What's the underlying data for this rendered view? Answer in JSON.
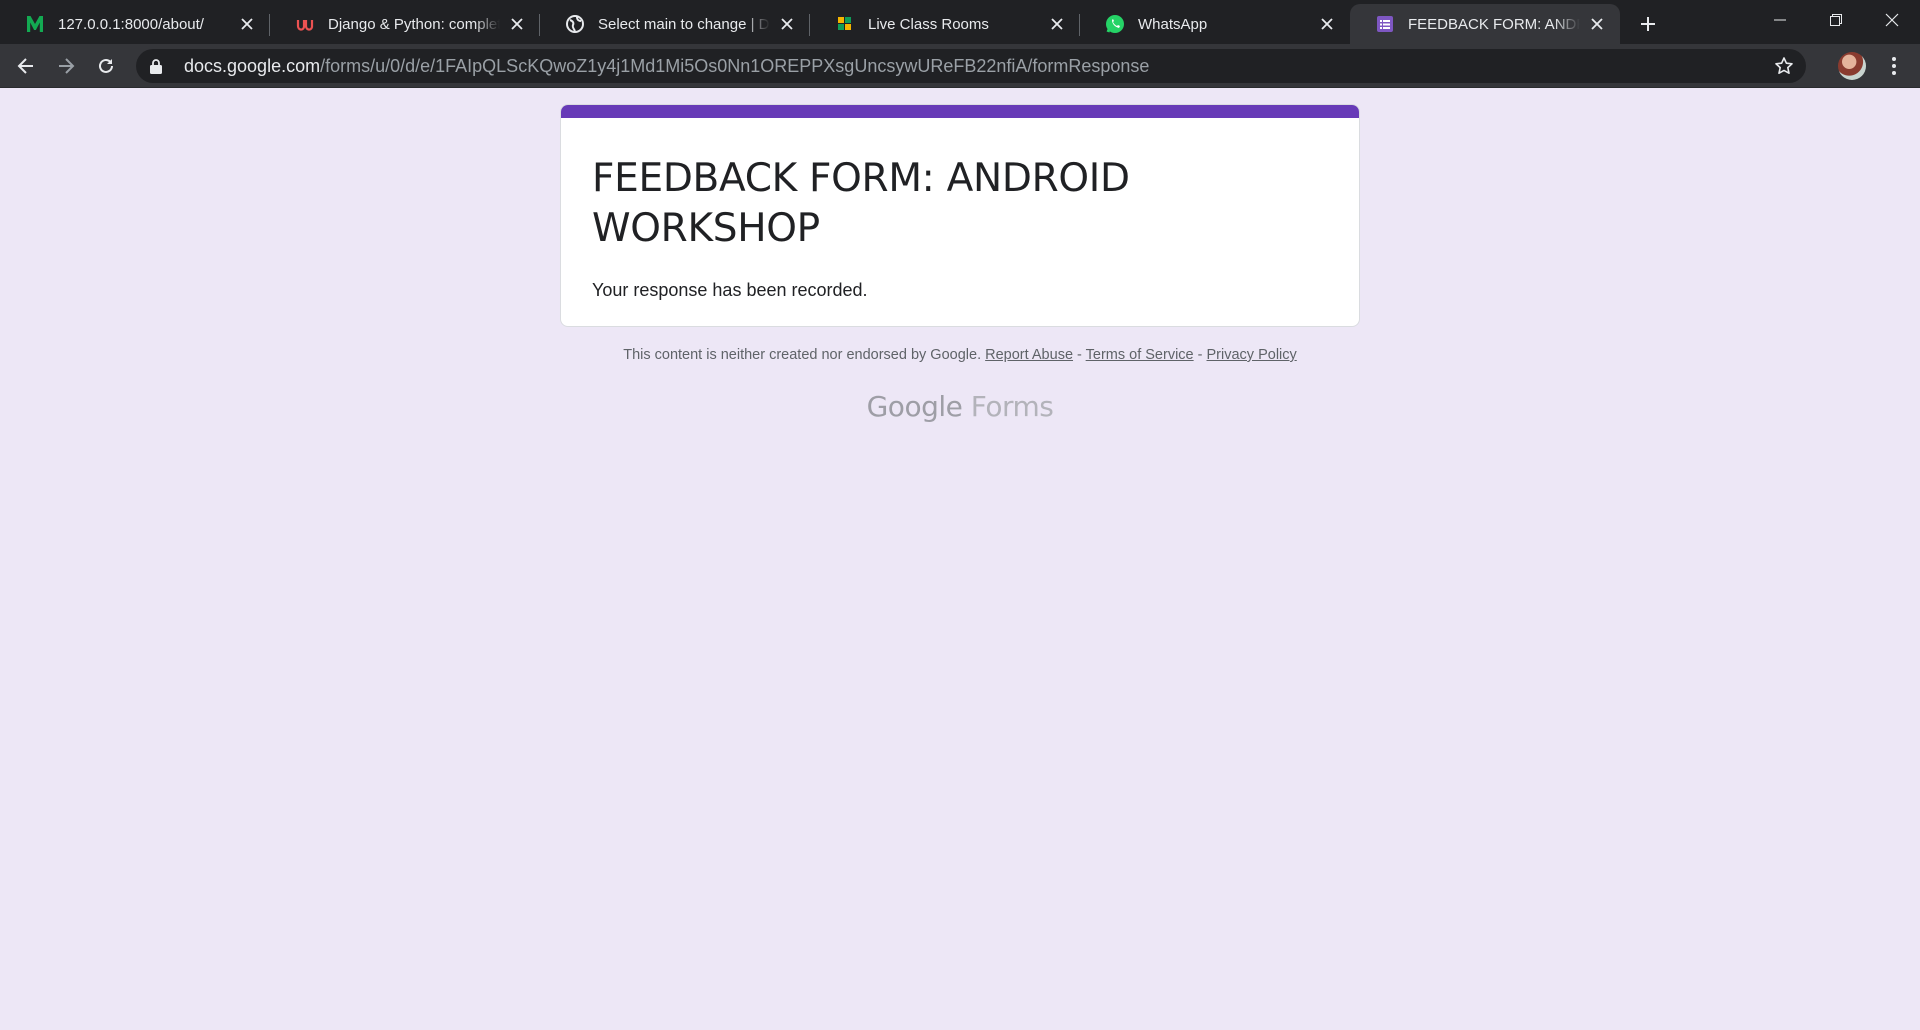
{
  "browser": {
    "tabs": [
      {
        "title": "127.0.0.1:8000/about/",
        "icon": "letter-m-icon"
      },
      {
        "title": "Django & Python: complete BUNDLE",
        "icon": "udemy-icon"
      },
      {
        "title": "Select main to change | Django site admin",
        "icon": "globe-icon"
      },
      {
        "title": "Live Class Rooms",
        "icon": "classroom-icon"
      },
      {
        "title": "WhatsApp",
        "icon": "whatsapp-icon"
      },
      {
        "title": "FEEDBACK FORM: ANDROID WORKSHOP",
        "icon": "google-forms-icon",
        "active": true
      }
    ],
    "address": {
      "host": "docs.google.com",
      "path": "/forms/u/0/d/e/1FAIpQLScKQwoZ1y4j1Md1Mi5Os0Nn1OREPPXsgUncsywUReFB22nfiA/formResponse"
    }
  },
  "form": {
    "title": "FEEDBACK FORM: ANDROID WORKSHOP",
    "confirmation": "Your response has been recorded.",
    "accent_color": "#673ab7"
  },
  "footer": {
    "disclaimer": "This content is neither created nor endorsed by Google.",
    "report_abuse": "Report Abuse",
    "terms": "Terms of Service",
    "privacy": "Privacy Policy",
    "separator": " - ",
    "brand_google": "Google",
    "brand_forms": "Forms"
  }
}
